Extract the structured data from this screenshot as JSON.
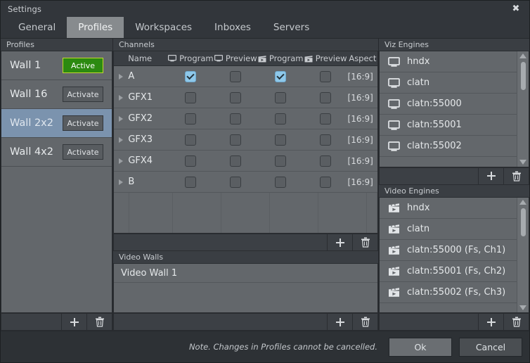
{
  "window": {
    "title": "Settings",
    "close_icon": "close-icon"
  },
  "tabs": [
    {
      "label": "General",
      "active": false
    },
    {
      "label": "Profiles",
      "active": true
    },
    {
      "label": "Workspaces",
      "active": false
    },
    {
      "label": "Inboxes",
      "active": false
    },
    {
      "label": "Servers",
      "active": false
    }
  ],
  "profiles": {
    "header": "Profiles",
    "items": [
      {
        "name": "Wall 1",
        "button": "Active",
        "state": "active",
        "selected": false
      },
      {
        "name": "Wall 16",
        "button": "Activate",
        "state": "inactive",
        "selected": false
      },
      {
        "name": "Wall 2x2",
        "button": "Activate",
        "state": "inactive",
        "selected": true
      },
      {
        "name": "Wall 4x2",
        "button": "Activate",
        "state": "inactive",
        "selected": false
      }
    ],
    "toolbar": {
      "add": "add-icon",
      "delete": "delete-icon"
    }
  },
  "channels": {
    "header": "Channels",
    "columns": [
      {
        "label": "Name",
        "icon": null
      },
      {
        "label": "Program",
        "icon": "monitor-icon"
      },
      {
        "label": "Preview",
        "icon": "monitor-icon"
      },
      {
        "label": "Program",
        "icon": "clapperboard-icon"
      },
      {
        "label": "Preview",
        "icon": "clapperboard-icon"
      },
      {
        "label": "Aspect",
        "icon": null
      }
    ],
    "rows": [
      {
        "name": "A",
        "viz_program": true,
        "viz_preview": false,
        "video_program": true,
        "video_preview": false,
        "aspect": "[16:9]"
      },
      {
        "name": "GFX1",
        "viz_program": false,
        "viz_preview": false,
        "video_program": false,
        "video_preview": false,
        "aspect": "[16:9]"
      },
      {
        "name": "GFX2",
        "viz_program": false,
        "viz_preview": false,
        "video_program": false,
        "video_preview": false,
        "aspect": "[16:9]"
      },
      {
        "name": "GFX3",
        "viz_program": false,
        "viz_preview": false,
        "video_program": false,
        "video_preview": false,
        "aspect": "[16:9]"
      },
      {
        "name": "GFX4",
        "viz_program": false,
        "viz_preview": false,
        "video_program": false,
        "video_preview": false,
        "aspect": "[16:9]"
      },
      {
        "name": "B",
        "viz_program": false,
        "viz_preview": false,
        "video_program": false,
        "video_preview": false,
        "aspect": "[16:9]"
      }
    ],
    "toolbar": {
      "add": "add-icon",
      "delete": "delete-icon"
    }
  },
  "video_walls": {
    "header": "Video Walls",
    "items": [
      {
        "name": "Video Wall 1"
      }
    ],
    "toolbar": {
      "add": "add-icon",
      "delete": "delete-icon"
    }
  },
  "viz_engines": {
    "header": "Viz Engines",
    "items": [
      {
        "name": "hndx",
        "icon": "monitor-icon"
      },
      {
        "name": "clatn",
        "icon": "monitor-icon"
      },
      {
        "name": "clatn:55000",
        "icon": "monitor-icon"
      },
      {
        "name": "clatn:55001",
        "icon": "monitor-icon"
      },
      {
        "name": "clatn:55002",
        "icon": "monitor-icon"
      }
    ],
    "toolbar": {
      "add": "add-icon",
      "delete": "delete-icon"
    }
  },
  "video_engines": {
    "header": "Video Engines",
    "items": [
      {
        "name": "hndx",
        "icon": "clapperboard-icon"
      },
      {
        "name": "clatn",
        "icon": "clapperboard-icon"
      },
      {
        "name": "clatn:55000 (Fs, Ch1)",
        "icon": "clapperboard-icon"
      },
      {
        "name": "clatn:55001 (Fs, Ch2)",
        "icon": "clapperboard-icon"
      },
      {
        "name": "clatn:55002 (Fs, Ch3)",
        "icon": "clapperboard-icon"
      }
    ],
    "toolbar": {
      "add": "add-icon",
      "delete": "delete-icon"
    }
  },
  "footer": {
    "note": "Note. Changes in Profiles cannot be cancelled.",
    "ok": "Ok",
    "cancel": "Cancel"
  },
  "colors": {
    "window_bg": "#32363b",
    "panel_bg": "#63676b",
    "header_bg": "#3a3e43",
    "selection": "#7b93ae",
    "active_green": "#2c8a10",
    "active_border": "#c2d730",
    "checkbox_on": "#8ec8ea"
  }
}
